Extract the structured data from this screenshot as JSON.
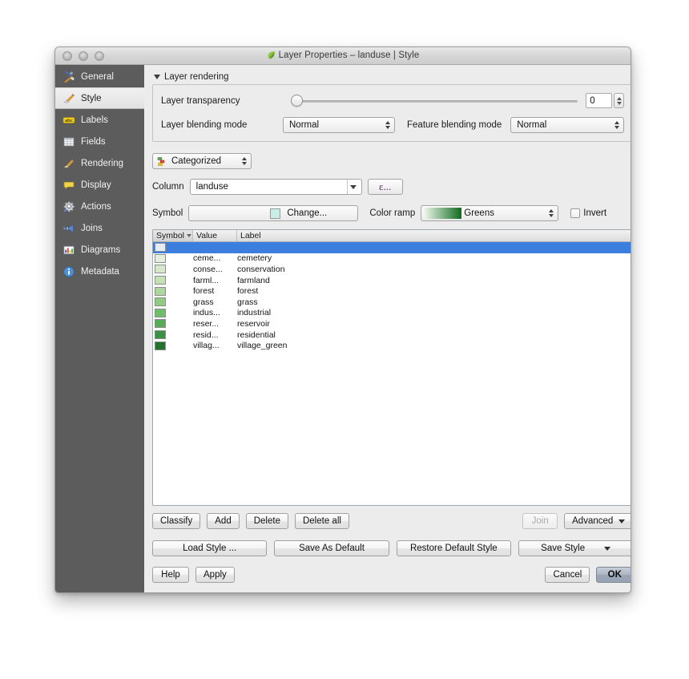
{
  "window": {
    "title": "Layer Properties – landuse | Style",
    "title_icon": "qgis-leaf-icon",
    "traffic_lights": [
      "close-button",
      "minimize-button",
      "zoom-button"
    ]
  },
  "sidebar": {
    "items": [
      {
        "label": "General",
        "icon": "tools-icon",
        "active": false
      },
      {
        "label": "Style",
        "icon": "brush-icon",
        "active": true
      },
      {
        "label": "Labels",
        "icon": "abc-label-icon",
        "active": false
      },
      {
        "label": "Fields",
        "icon": "table-icon",
        "active": false
      },
      {
        "label": "Rendering",
        "icon": "broom-icon",
        "active": false
      },
      {
        "label": "Display",
        "icon": "speech-bubble-icon",
        "active": false
      },
      {
        "label": "Actions",
        "icon": "gear-icon",
        "active": false
      },
      {
        "label": "Joins",
        "icon": "join-arrow-icon",
        "active": false
      },
      {
        "label": "Diagrams",
        "icon": "chart-icon",
        "active": false
      },
      {
        "label": "Metadata",
        "icon": "info-icon",
        "active": false
      }
    ]
  },
  "layer_rendering": {
    "group_label": "Layer rendering",
    "transparency_label": "Layer transparency",
    "transparency_value": "0",
    "transparency_slider_percent": 0,
    "blending_label": "Layer blending mode",
    "blending_value": "Normal",
    "feature_blending_label": "Feature blending mode",
    "feature_blending_value": "Normal"
  },
  "renderer": {
    "value": "Categorized",
    "icon": "categorized-icon"
  },
  "column": {
    "label": "Column",
    "value": "landuse",
    "expression_button_label": "ε..."
  },
  "symbol": {
    "label": "Symbol",
    "change_label": "Change...",
    "swatch_color": "#cdece8"
  },
  "color_ramp": {
    "label": "Color ramp",
    "value": "Greens",
    "gradient_from": "#f0f8ec",
    "gradient_to": "#116b22",
    "invert_label": "Invert",
    "invert_checked": false
  },
  "table": {
    "headers": [
      "Symbol",
      "Value",
      "Label"
    ],
    "sort_column": "Symbol",
    "rows": [
      {
        "color": "#e6ecf5",
        "value": "",
        "label": "",
        "selected": true
      },
      {
        "color": "#e3efdc",
        "value": "ceme...",
        "label": "cemetery",
        "selected": false
      },
      {
        "color": "#d5e8ca",
        "value": "conse...",
        "label": "conservation",
        "selected": false
      },
      {
        "color": "#c4e0b5",
        "value": "farml...",
        "label": "farmland",
        "selected": false
      },
      {
        "color": "#aed79d",
        "value": "forest",
        "label": "forest",
        "selected": false
      },
      {
        "color": "#8fcb80",
        "value": "grass",
        "label": "grass",
        "selected": false
      },
      {
        "color": "#72bd6a",
        "value": "indus...",
        "label": "industrial",
        "selected": false
      },
      {
        "color": "#56ac58",
        "value": "reser...",
        "label": "reservoir",
        "selected": false
      },
      {
        "color": "#3a9145",
        "value": "resid...",
        "label": "residential",
        "selected": false
      },
      {
        "color": "#23702f",
        "value": "villag...",
        "label": "village_green",
        "selected": false
      }
    ]
  },
  "classify_bar": {
    "classify": "Classify",
    "add": "Add",
    "delete": "Delete",
    "delete_all": "Delete all",
    "join": "Join",
    "join_disabled": true,
    "advanced": "Advanced"
  },
  "style_bar": {
    "load_style": "Load Style ...",
    "save_as_default": "Save As Default",
    "restore_default_style": "Restore Default Style",
    "save_style": "Save Style"
  },
  "dialog_bar": {
    "help": "Help",
    "apply": "Apply",
    "cancel": "Cancel",
    "ok": "OK"
  },
  "colors": {
    "selection_blue": "#3b7ede",
    "sidebar_bg": "#5c5c5c",
    "pane_bg": "#ececec"
  }
}
